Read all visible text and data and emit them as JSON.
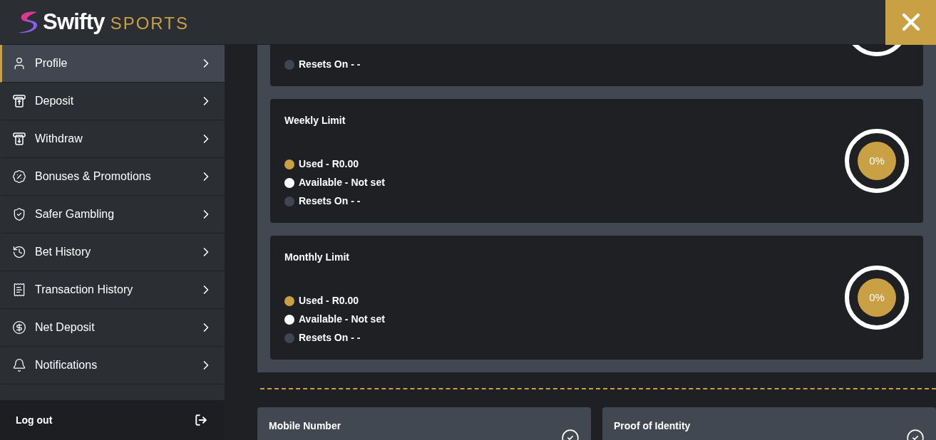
{
  "header": {
    "logo_word": "Swifty",
    "logo_sub": "SPORTS"
  },
  "sidebar": {
    "items": [
      {
        "label": "Profile",
        "kind": "user",
        "selected": true
      },
      {
        "label": "Deposit",
        "kind": "deposit",
        "selected": false
      },
      {
        "label": "Withdraw",
        "kind": "withdraw",
        "selected": false
      },
      {
        "label": "Bonuses & Promotions",
        "kind": "badge",
        "selected": false
      },
      {
        "label": "Safer Gambling",
        "kind": "shield",
        "selected": false
      },
      {
        "label": "Bet History",
        "kind": "history",
        "selected": false
      },
      {
        "label": "Transaction History",
        "kind": "list",
        "selected": false
      },
      {
        "label": "Net Deposit",
        "kind": "coin",
        "selected": false
      },
      {
        "label": "Notifications",
        "kind": "bell",
        "selected": false
      }
    ],
    "logout": "Log out"
  },
  "limits": [
    {
      "rows": [
        {
          "label": "Resets On - -",
          "color": "#404651"
        }
      ]
    },
    {
      "title": "Weekly Limit",
      "percent": "0%",
      "rows": [
        {
          "label": "Used - R0.00",
          "color": "#c9a043"
        },
        {
          "label": "Available - Not set",
          "color": "#ffffff"
        },
        {
          "label": "Resets On - -",
          "color": "#404651"
        }
      ]
    },
    {
      "title": "Monthly Limit",
      "percent": "0%",
      "rows": [
        {
          "label": "Used - R0.00",
          "color": "#c9a043"
        },
        {
          "label": "Available - Not set",
          "color": "#ffffff"
        },
        {
          "label": "Resets On - -",
          "color": "#404651"
        }
      ]
    }
  ],
  "verifications": [
    {
      "title": "Mobile Number",
      "verified": true
    },
    {
      "title": "Proof of Identity",
      "verified": true
    }
  ]
}
